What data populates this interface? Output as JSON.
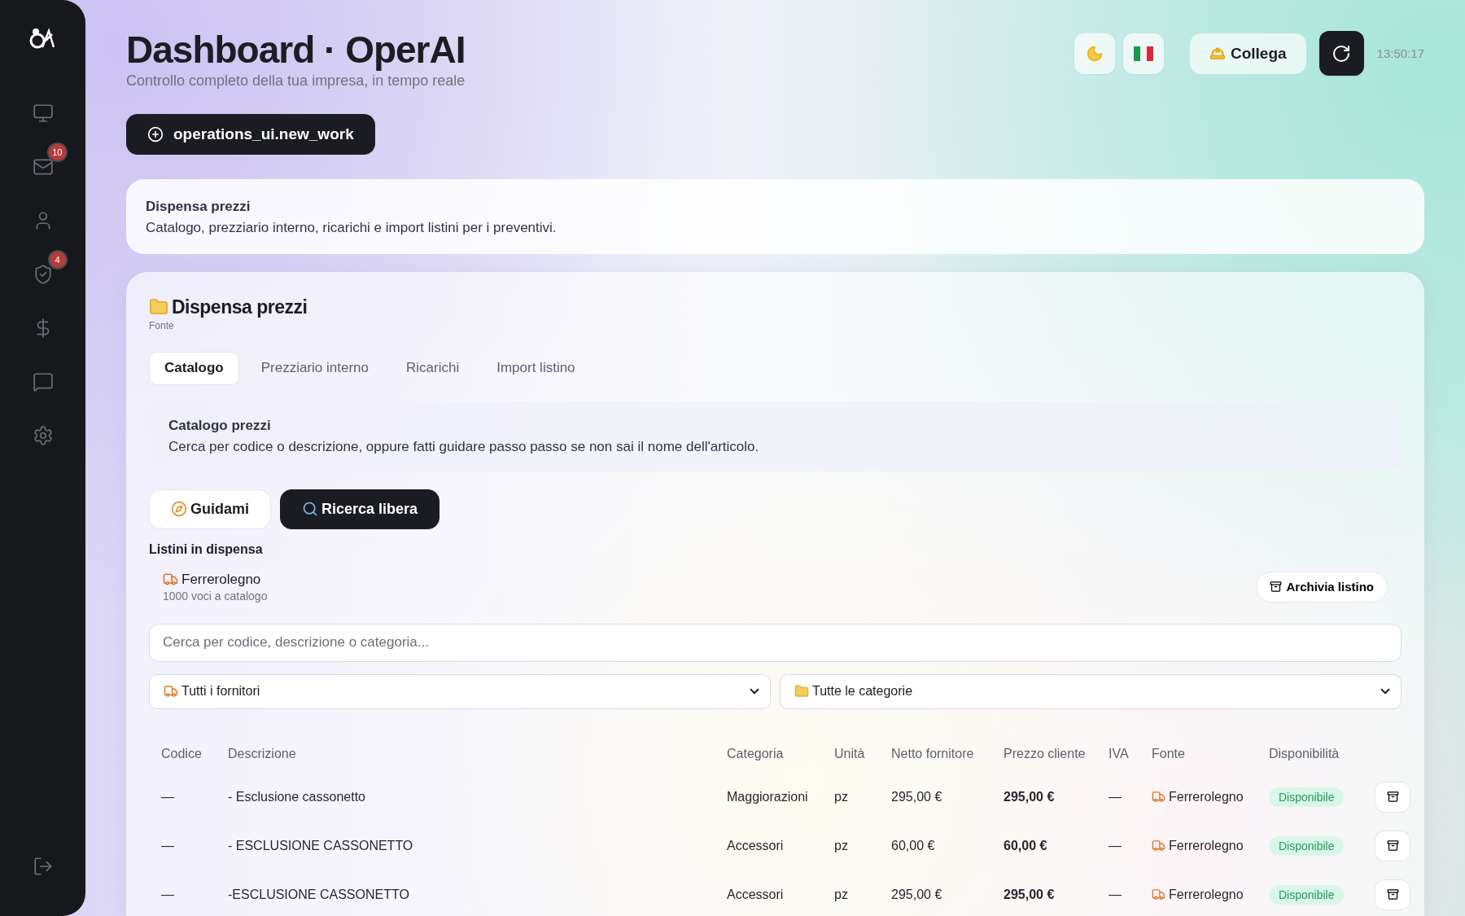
{
  "sidebar": {
    "items": [
      {
        "kind": "monitor"
      },
      {
        "kind": "mail",
        "badge": "10"
      },
      {
        "kind": "user"
      },
      {
        "kind": "shield",
        "badge": "4"
      },
      {
        "kind": "dollar"
      },
      {
        "kind": "chat"
      },
      {
        "kind": "settings"
      }
    ],
    "footer": {
      "kind": "logout"
    }
  },
  "header": {
    "title": "Dashboard · OperAI",
    "subtitle": "Controllo completo della tua impresa, in tempo reale",
    "connect_label": "Collega",
    "time": "13:50:17"
  },
  "new_work_label": "operations_ui.new_work",
  "info_card": {
    "title": "Dispensa prezzi",
    "text": "Catalogo, prezziario interno, ricarichi e import listini per i preventivi."
  },
  "panel": {
    "title": "Dispensa prezzi",
    "caption": "Fonte",
    "tabs": [
      {
        "label": "Catalogo",
        "selected": true
      },
      {
        "label": "Prezziario interno",
        "selected": false
      },
      {
        "label": "Ricarichi",
        "selected": false
      },
      {
        "label": "Import listino",
        "selected": false
      }
    ],
    "section": {
      "title": "Catalogo prezzi",
      "text": "Cerca per codice o descrizione, oppure fatti guidare passo passo se non sai il nome dell'articolo."
    },
    "modes": [
      {
        "kind": "guide",
        "label": "Guidami",
        "selected": false
      },
      {
        "kind": "search",
        "label": "Ricerca libera",
        "selected": true
      }
    ],
    "lists_title": "Listini in dispensa",
    "lists": [
      {
        "name": "Ferrerolegno",
        "count": "1000 voci a catalogo",
        "action": "Archivia listino"
      }
    ],
    "search": {
      "placeholder": "Cerca per codice, descrizione o categoria..."
    },
    "filters": [
      {
        "kind": "supplier",
        "value": "Tutti i fornitori"
      },
      {
        "kind": "category",
        "value": "Tutte le categorie"
      }
    ],
    "table": {
      "columns": [
        "Codice",
        "Descrizione",
        "Categoria",
        "Unità",
        "Netto fornitore",
        "Prezzo cliente",
        "IVA",
        "Fonte",
        "Disponibilità"
      ],
      "rows": [
        {
          "code": "—",
          "description": "- Esclusione cassonetto",
          "category": "Maggiorazioni",
          "unit": "pz",
          "net": "295,00 €",
          "price": "295,00 €",
          "vat": "—",
          "source": "Ferrerolegno",
          "availability": "Disponibile"
        },
        {
          "code": "—",
          "description": "- ESCLUSIONE CASSONETTO",
          "category": "Accessori",
          "unit": "pz",
          "net": "60,00 €",
          "price": "60,00 €",
          "vat": "—",
          "source": "Ferrerolegno",
          "availability": "Disponibile"
        },
        {
          "code": "—",
          "description": "-ESCLUSIONE CASSONETTO",
          "category": "Accessori",
          "unit": "pz",
          "net": "295,00 €",
          "price": "295,00 €",
          "vat": "—",
          "source": "Ferrerolegno",
          "availability": "Disponibile"
        }
      ]
    }
  }
}
